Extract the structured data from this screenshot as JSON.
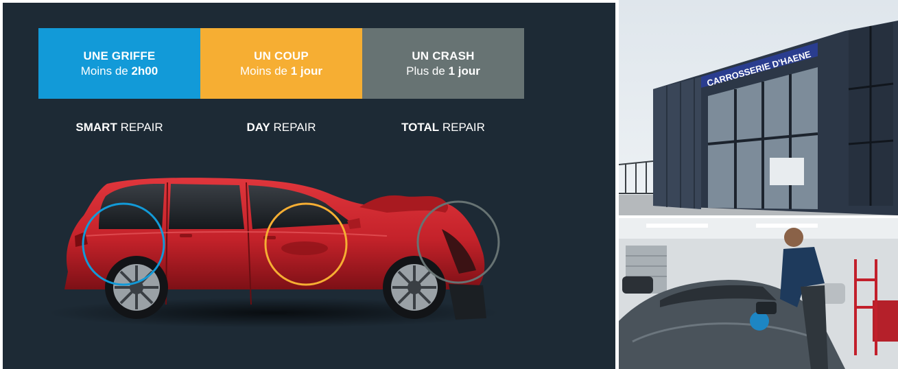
{
  "colors": {
    "background": "#1d2a35",
    "smart": "#129ad8",
    "day": "#f6ae33",
    "total": "#677373",
    "car_body": "#c4222a"
  },
  "categories": [
    {
      "title": "UNE GRIFFE",
      "duration_prefix": "Moins de ",
      "duration_value": "2h00",
      "repair_bold": "SMART",
      "repair_rest": " REPAIR"
    },
    {
      "title": "UN COUP",
      "duration_prefix": "Moins de ",
      "duration_value": "1 jour",
      "repair_bold": "DAY",
      "repair_rest": " REPAIR"
    },
    {
      "title": "UN CRASH",
      "duration_prefix": "Plus de ",
      "duration_value": "1 jour",
      "repair_bold": "TOTAL",
      "repair_rest": " REPAIR"
    }
  ],
  "building_sign": "CARROSSERIE D'HAENE"
}
